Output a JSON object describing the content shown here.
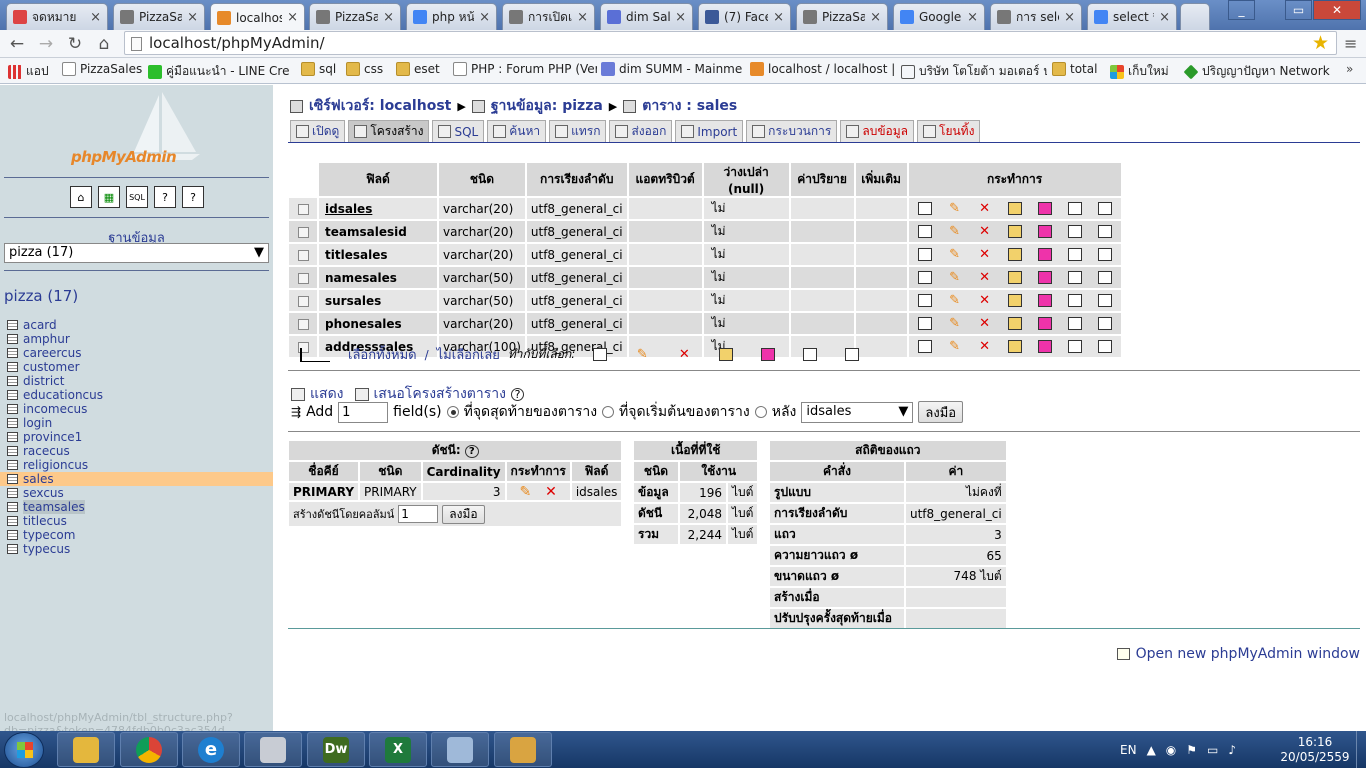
{
  "browser": {
    "tabs": [
      {
        "title": "จดหมาย",
        "color": "#d44"
      },
      {
        "title": "PizzaSal",
        "color": "#777"
      },
      {
        "title": "localhos",
        "color": "#e78a2a",
        "active": true
      },
      {
        "title": "PizzaSal",
        "color": "#777"
      },
      {
        "title": "php หน้",
        "color": "#4285f4"
      },
      {
        "title": "การเปิดเ",
        "color": "#777"
      },
      {
        "title": "dim Sal",
        "color": "#5a6fd6"
      },
      {
        "title": "(7) Face",
        "color": "#3b5998"
      },
      {
        "title": "PizzaSal",
        "color": "#777"
      },
      {
        "title": "Google",
        "color": "#4285f4"
      },
      {
        "title": "การ sele",
        "color": "#777"
      },
      {
        "title": "select *",
        "color": "#4285f4"
      }
    ],
    "address": "localhost/phpMyAdmin/",
    "bookmarks": [
      {
        "label": "แอป",
        "icon": "apps-icon"
      },
      {
        "label": "PizzaSales",
        "icon": "page-icon"
      },
      {
        "label": "คู่มือแนะนำ - LINE Cre",
        "icon": "line-icon"
      },
      {
        "label": "sql",
        "icon": "folder-icon"
      },
      {
        "label": "css",
        "icon": "folder-icon"
      },
      {
        "label": "eset",
        "icon": "folder-icon"
      },
      {
        "label": "PHP : Forum PHP (Ver",
        "icon": "page-icon"
      },
      {
        "label": "dim SUMM - Mainme",
        "icon": "gear-icon"
      },
      {
        "label": "localhost / localhost |",
        "icon": "pma-icon"
      },
      {
        "label": "บริษัท โตโยต้า มอเตอร์ ป",
        "icon": "toyota-icon"
      },
      {
        "label": "total",
        "icon": "folder-icon"
      },
      {
        "label": "เก็บใหม่",
        "icon": "windows-icon"
      },
      {
        "label": "ปริญญาปัญหา Network ..",
        "icon": "diamond-icon"
      }
    ],
    "status_url": "localhost/phpMyAdmin/tbl_structure.php?db=pizza&token=4784fdb0b0c3ac354d"
  },
  "left": {
    "logo": "phpMyAdmin",
    "db_label": "ฐานข้อมูล",
    "db_select": "pizza (17)",
    "db_title": "pizza (17)",
    "tables": [
      "acard",
      "amphur",
      "careercus",
      "customer",
      "district",
      "educationcus",
      "incomecus",
      "login",
      "province1",
      "racecus",
      "religioncus",
      "sales",
      "sexcus",
      "teamsales",
      "titlecus",
      "typecom",
      "typecus"
    ],
    "selected": "sales",
    "highlighted": "teamsales"
  },
  "main": {
    "breadcrumb": {
      "server_label": "เซิร์ฟเวอร์: localhost",
      "db_label": "ฐานข้อมูล: pizza",
      "table_label": "ตาราง : sales"
    },
    "tabs": [
      {
        "label": "เปิดดู"
      },
      {
        "label": "โครงสร้าง",
        "active": true
      },
      {
        "label": "SQL"
      },
      {
        "label": "ค้นหา"
      },
      {
        "label": "แทรก"
      },
      {
        "label": "ส่งออก"
      },
      {
        "label": "Import"
      },
      {
        "label": "กระบวนการ"
      },
      {
        "label": "ลบข้อมูล",
        "red": true
      },
      {
        "label": "โยนทิ้ง",
        "red": true
      }
    ],
    "structure": {
      "headers": [
        "ฟิลด์",
        "ชนิด",
        "การเรียงลำดับ",
        "แอตทริบิวต์",
        "ว่างเปล่า (null)",
        "ค่าปริยาย",
        "เพิ่มเติม",
        "กระทำการ"
      ],
      "rows": [
        {
          "field": "idsales",
          "type": "varchar(20)",
          "collation": "utf8_general_ci",
          "null": "ไม่",
          "pk": true
        },
        {
          "field": "teamsalesid",
          "type": "varchar(20)",
          "collation": "utf8_general_ci",
          "null": "ไม่"
        },
        {
          "field": "titlesales",
          "type": "varchar(20)",
          "collation": "utf8_general_ci",
          "null": "ไม่"
        },
        {
          "field": "namesales",
          "type": "varchar(50)",
          "collation": "utf8_general_ci",
          "null": "ไม่"
        },
        {
          "field": "sursales",
          "type": "varchar(50)",
          "collation": "utf8_general_ci",
          "null": "ไม่"
        },
        {
          "field": "phonesales",
          "type": "varchar(20)",
          "collation": "utf8_general_ci",
          "null": "ไม่"
        },
        {
          "field": "addresssales",
          "type": "varchar(100)",
          "collation": "utf8_general_ci",
          "null": "ไม่"
        }
      ]
    },
    "select_all": "เลือกทั้งหมด",
    "unselect_all": "ไม่เลือกเลย",
    "with_selected": "ทำกับที่เลือก:",
    "print_view": "แสดง",
    "relation_view": "เสนอโครงสร้างตาราง",
    "add": {
      "label": "Add",
      "count": "1",
      "fields": "field(s)",
      "opt_end": "ที่จุดสุดท้ายของตาราง",
      "opt_begin": "ที่จุดเริ่มต้นของตาราง",
      "opt_after": "หลัง",
      "after_field": "idsales",
      "go": "ลงมือ"
    },
    "indexes": {
      "title": "ดัชนี:",
      "headers": [
        "ชื่อคีย์",
        "ชนิด",
        "Cardinality",
        "กระทำการ",
        "ฟิลด์"
      ],
      "row": {
        "key": "PRIMARY",
        "type": "PRIMARY",
        "cardinality": "3",
        "field": "idsales"
      },
      "create_label": "สร้างดัชนีโดยคอลัมน์",
      "create_count": "1",
      "go": "ลงมือ"
    },
    "space": {
      "title": "เนื้อที่ที่ใช้",
      "headers": [
        "ชนิด",
        "ใช้งาน"
      ],
      "rows": [
        {
          "type": "ข้อมูล",
          "value": "196",
          "unit": "ไบต์"
        },
        {
          "type": "ดัชนี",
          "value": "2,048",
          "unit": "ไบต์"
        },
        {
          "type": "รวม",
          "value": "2,244",
          "unit": "ไบต์"
        }
      ]
    },
    "stats": {
      "title": "สถิติของแถว",
      "headers": [
        "คำสั่ง",
        "ค่า"
      ],
      "rows": [
        {
          "k": "รูปแบบ",
          "v": "ไม่คงที่"
        },
        {
          "k": "การเรียงลำดับ",
          "v": "utf8_general_ci"
        },
        {
          "k": "แถว",
          "v": "3"
        },
        {
          "k": "ความยาวแถว ø",
          "v": "65"
        },
        {
          "k": "ขนาดแถว ø",
          "v": "748 ไบต์"
        },
        {
          "k": "สร้างเมื่อ",
          "v": ""
        },
        {
          "k": "ปรับปรุงครั้งสุดท้ายเมื่อ",
          "v": ""
        }
      ]
    },
    "new_window": "Open new phpMyAdmin window"
  },
  "taskbar": {
    "apps": [
      {
        "name": "explorer",
        "label": "",
        "color": "#e4b73d"
      },
      {
        "name": "chrome",
        "label": "",
        "color": "#db4437"
      },
      {
        "name": "ie",
        "label": "e",
        "color": "#1e7fd0"
      },
      {
        "name": "calculator",
        "label": "",
        "color": "#c8ccd4"
      },
      {
        "name": "dreamweaver",
        "label": "Dw",
        "color": "#3f6b20"
      },
      {
        "name": "excel",
        "label": "X",
        "color": "#1f7a3c"
      },
      {
        "name": "notes",
        "label": "",
        "color": "#9fb9d9"
      },
      {
        "name": "paint",
        "label": "",
        "color": "#d9a441"
      }
    ],
    "lang": "EN",
    "time": "16:16",
    "date": "20/05/2559"
  }
}
